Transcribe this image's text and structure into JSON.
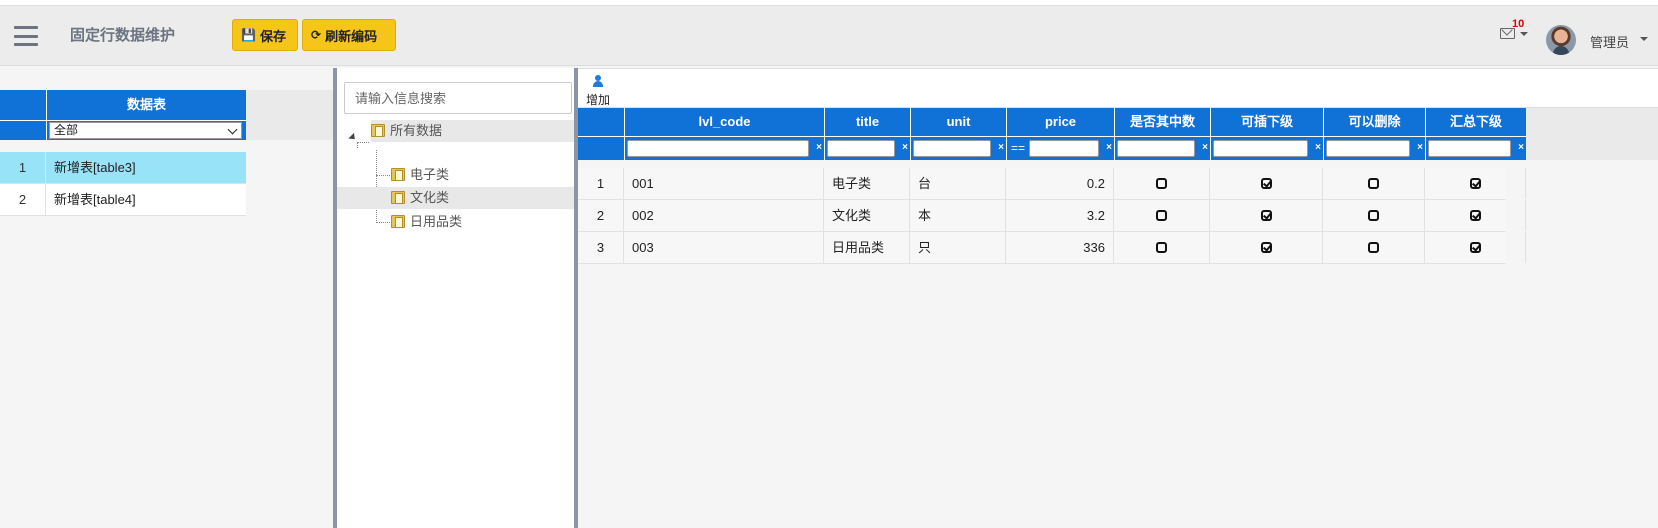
{
  "header": {
    "title": "固定行数据维护",
    "save_label": "保存",
    "refresh_label": "刷新编码",
    "mail_count": "10",
    "username": "管理员"
  },
  "left_table": {
    "column_header": "数据表",
    "filter_value": "全部",
    "rows": [
      {
        "num": "1",
        "name": "新增表[table3]",
        "selected": true
      },
      {
        "num": "2",
        "name": "新增表[table4]",
        "selected": false
      }
    ]
  },
  "tree": {
    "search_placeholder": "请输入信息搜索",
    "root": "所有数据",
    "children": [
      "电子类",
      "文化类",
      "日用品类"
    ]
  },
  "grid": {
    "add_label": "增加",
    "columns": [
      "lvl_code",
      "title",
      "unit",
      "price",
      "是否其中数",
      "可插下级",
      "可以删除",
      "汇总下级"
    ],
    "filter_eq": "==",
    "filter_clear": "×",
    "rows": [
      {
        "num": "1",
        "lvl_code": "001",
        "title": "电子类",
        "unit": "台",
        "price": "0.2",
        "is_part": false,
        "can_insert": true,
        "can_delete": false,
        "sum_sub": true
      },
      {
        "num": "2",
        "lvl_code": "002",
        "title": "文化类",
        "unit": "本",
        "price": "3.2",
        "is_part": false,
        "can_insert": true,
        "can_delete": false,
        "sum_sub": true
      },
      {
        "num": "3",
        "lvl_code": "003",
        "title": "日用品类",
        "unit": "只",
        "price": "336",
        "is_part": false,
        "can_insert": true,
        "can_delete": false,
        "sum_sub": true
      }
    ]
  },
  "colors": {
    "accent": "#1071d6",
    "button": "#f5c518",
    "selected_row": "#99e3f8",
    "badge": "#e00000"
  }
}
